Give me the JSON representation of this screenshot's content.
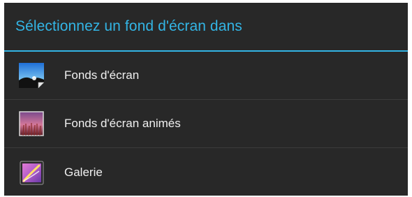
{
  "dialog": {
    "title": "Sélectionnez un fond d'écran dans",
    "accent_color": "#33b5e5",
    "items": [
      {
        "label": "Fonds d'écran",
        "icon": "wallpapers-icon"
      },
      {
        "label": "Fonds d'écran animés",
        "icon": "live-wallpapers-icon"
      },
      {
        "label": "Galerie",
        "icon": "gallery-icon"
      }
    ]
  }
}
